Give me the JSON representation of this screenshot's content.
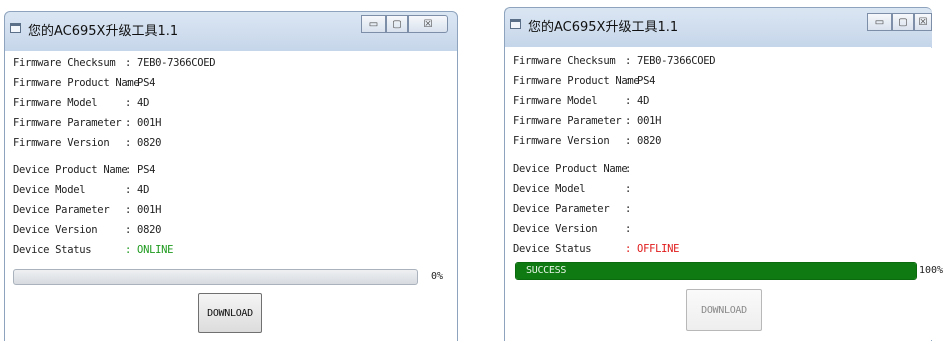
{
  "windows": [
    {
      "title": "您的AC695X升级工具1.1",
      "controls": {
        "minimize": "▭",
        "maximize": "▢",
        "close": "☒"
      },
      "firmware": [
        {
          "label": "Firmware Checksum",
          "value": ": 7EB0-7366COED"
        },
        {
          "label": "Firmware Product Name",
          "value": ": PS4"
        },
        {
          "label": "Firmware Model",
          "value": ": 4D"
        },
        {
          "label": "Firmware Parameter",
          "value": ": 001H"
        },
        {
          "label": "Firmware Version",
          "value": ": 0820"
        }
      ],
      "device": [
        {
          "label": "Device Product Name",
          "value": ": PS4"
        },
        {
          "label": "Device Model",
          "value": ": 4D"
        },
        {
          "label": "Device Parameter",
          "value": ": 001H"
        },
        {
          "label": "Device Version",
          "value": ": 0820"
        },
        {
          "label": "Device Status",
          "value": ": ONLINE"
        }
      ],
      "progress": {
        "value": 0,
        "percent_label": "0%",
        "bar_text": ""
      },
      "download_button": "DOWNLOAD",
      "download_enabled": true
    },
    {
      "title": "您的AC695X升级工具1.1",
      "controls": {
        "minimize": "▭",
        "maximize": "▢",
        "close": "☒"
      },
      "firmware": [
        {
          "label": "Firmware Checksum",
          "value": ": 7EB0-7366COED"
        },
        {
          "label": "Firmware Product Name",
          "value": ": PS4"
        },
        {
          "label": "Firmware Model",
          "value": ": 4D"
        },
        {
          "label": "Firmware Parameter",
          "value": ": 001H"
        },
        {
          "label": "Firmware Version",
          "value": ": 0820"
        }
      ],
      "device": [
        {
          "label": "Device Product Name",
          "value": ":"
        },
        {
          "label": "Device Model",
          "value": ":"
        },
        {
          "label": "Device Parameter",
          "value": ":"
        },
        {
          "label": "Device Version",
          "value": ":"
        },
        {
          "label": "Device Status",
          "value": ": OFFLINE"
        }
      ],
      "progress": {
        "value": 100,
        "percent_label": "100%",
        "bar_text": "SUCCESS"
      },
      "download_button": "DOWNLOAD",
      "download_enabled": false
    }
  ],
  "colors": {
    "online": "#1e9a1e",
    "offline": "#e01a1a",
    "progress_fill": "#0f7a12"
  }
}
